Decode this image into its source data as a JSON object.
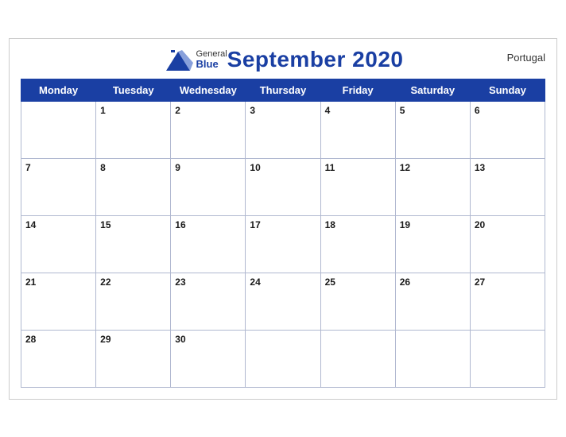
{
  "calendar": {
    "title": "September 2020",
    "country": "Portugal",
    "days_of_week": [
      "Monday",
      "Tuesday",
      "Wednesday",
      "Thursday",
      "Friday",
      "Saturday",
      "Sunday"
    ],
    "weeks": [
      {
        "days": [
          {
            "num": "",
            "empty": true
          },
          {
            "num": "1"
          },
          {
            "num": "2"
          },
          {
            "num": "3"
          },
          {
            "num": "4"
          },
          {
            "num": "5"
          },
          {
            "num": "6"
          }
        ]
      },
      {
        "days": [
          {
            "num": "7"
          },
          {
            "num": "8"
          },
          {
            "num": "9"
          },
          {
            "num": "10"
          },
          {
            "num": "11"
          },
          {
            "num": "12"
          },
          {
            "num": "13"
          }
        ]
      },
      {
        "days": [
          {
            "num": "14"
          },
          {
            "num": "15"
          },
          {
            "num": "16"
          },
          {
            "num": "17"
          },
          {
            "num": "18"
          },
          {
            "num": "19"
          },
          {
            "num": "20"
          }
        ]
      },
      {
        "days": [
          {
            "num": "21"
          },
          {
            "num": "22"
          },
          {
            "num": "23"
          },
          {
            "num": "24"
          },
          {
            "num": "25"
          },
          {
            "num": "26"
          },
          {
            "num": "27"
          }
        ]
      },
      {
        "days": [
          {
            "num": "28"
          },
          {
            "num": "29"
          },
          {
            "num": "30"
          },
          {
            "num": "",
            "empty": true
          },
          {
            "num": "",
            "empty": true
          },
          {
            "num": "",
            "empty": true
          },
          {
            "num": "",
            "empty": true
          }
        ]
      }
    ],
    "logo": {
      "general": "General",
      "blue": "Blue"
    }
  }
}
